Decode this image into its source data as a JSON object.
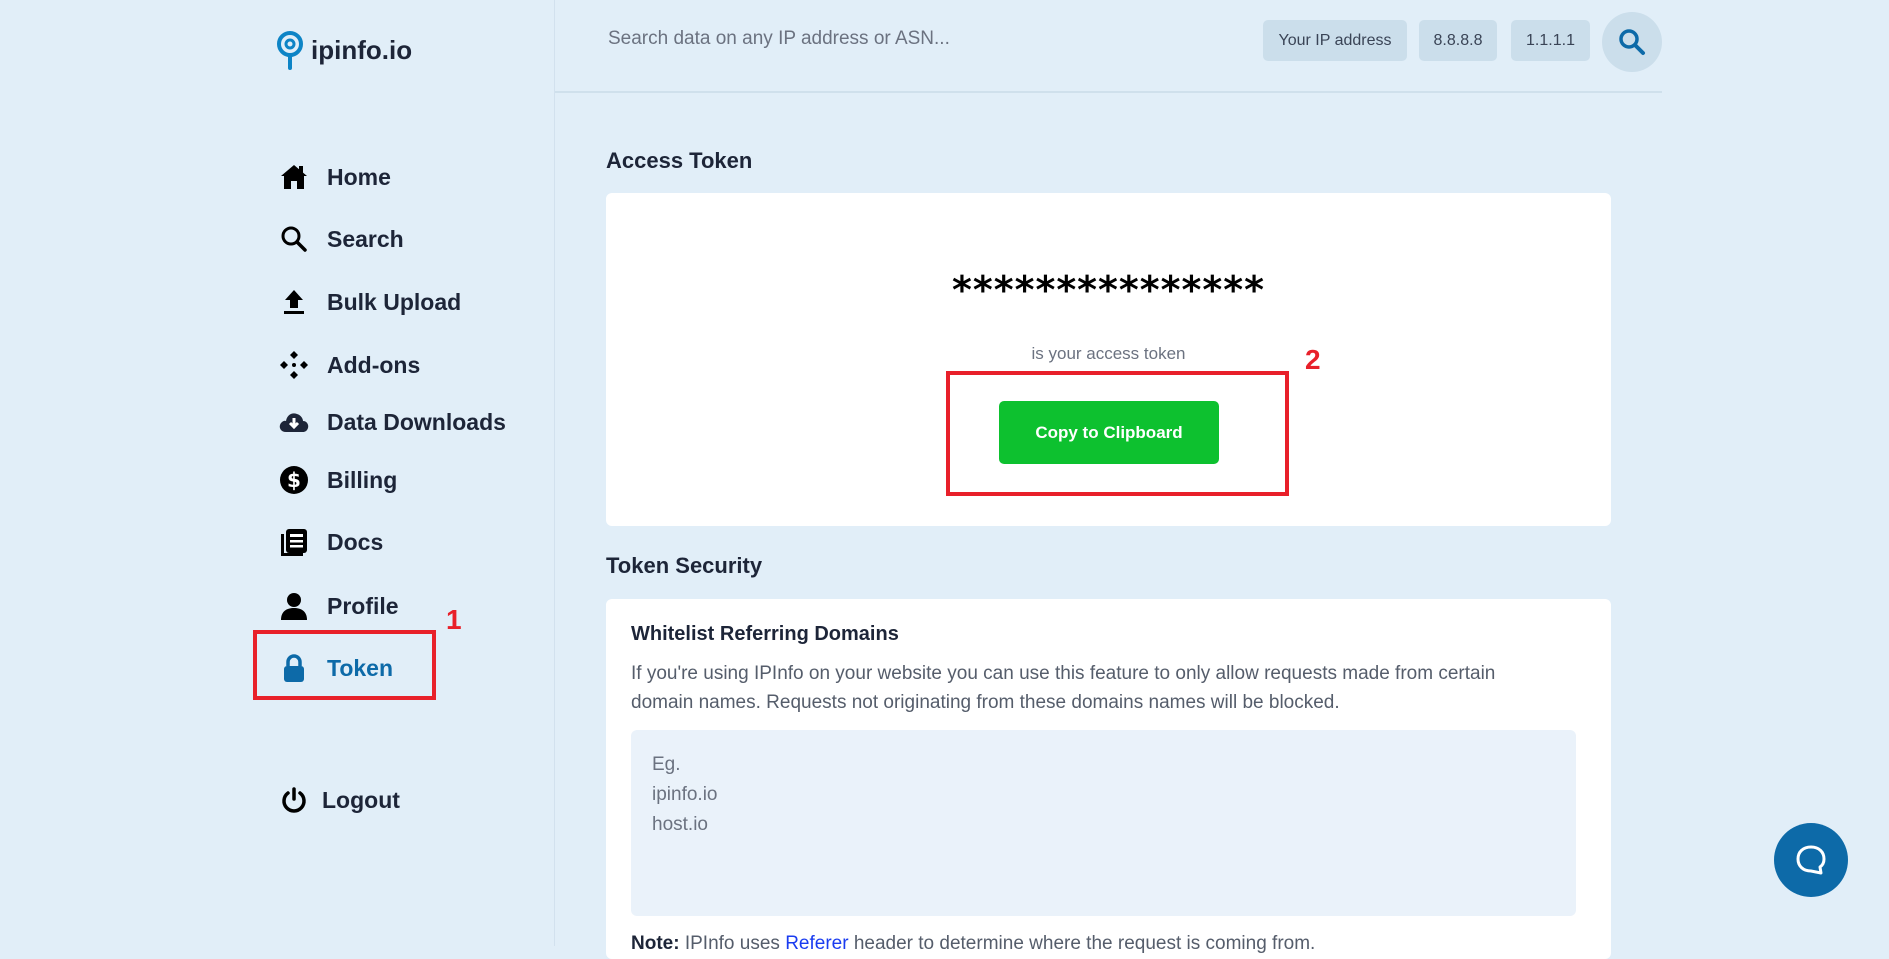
{
  "brand": {
    "name": "ipinfo.io",
    "color": "#0d84c6"
  },
  "sidebar": {
    "items": [
      {
        "label": "Home",
        "icon": "home-icon"
      },
      {
        "label": "Search",
        "icon": "search-icon"
      },
      {
        "label": "Bulk Upload",
        "icon": "upload-icon"
      },
      {
        "label": "Add-ons",
        "icon": "addons-icon"
      },
      {
        "label": "Data Downloads",
        "icon": "cloud-download-icon"
      },
      {
        "label": "Billing",
        "icon": "dollar-icon"
      },
      {
        "label": "Docs",
        "icon": "docs-icon"
      },
      {
        "label": "Profile",
        "icon": "user-icon"
      },
      {
        "label": "Token",
        "icon": "lock-icon",
        "active": true
      }
    ],
    "logout": "Logout"
  },
  "header": {
    "search_placeholder": "Search data on any IP address or ASN...",
    "quick": [
      "Your IP address",
      "8.8.8.8",
      "1.1.1.1"
    ]
  },
  "access": {
    "title": "Access Token",
    "token": "***************",
    "caption": "is your access token",
    "copy": "Copy to Clipboard"
  },
  "security": {
    "title": "Token Security",
    "subtitle": "Whitelist Referring Domains",
    "desc1": "If you're using IPInfo on your website you can use this feature to only allow requests made from certain",
    "desc2": "domain names. Requests not originating from these domains names will be blocked.",
    "placeholder_lines": [
      "Eg.",
      "ipinfo.io",
      "host.io"
    ],
    "note_label": "Note:",
    "note_pre": " IPInfo uses ",
    "note_link": "Referer",
    "note_post": " header to determine where the request is coming from."
  },
  "annotations": [
    "1",
    "2"
  ],
  "colors": {
    "accent": "#0d6aa8",
    "green": "#0dc12f",
    "red": "#e8202a"
  }
}
